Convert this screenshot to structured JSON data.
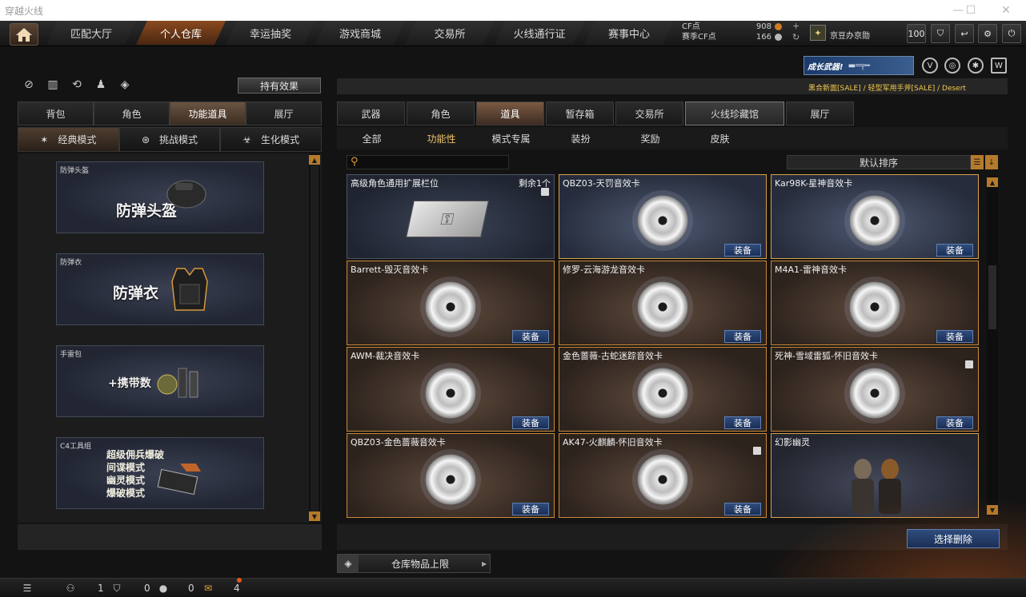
{
  "window": {
    "title": "穿越火线"
  },
  "nav": {
    "tabs": [
      "匹配大厅",
      "个人仓库",
      "幸运抽奖",
      "游戏商城",
      "交易所",
      "火线通行证",
      "赛事中心"
    ],
    "active_index": 1
  },
  "currency": {
    "cf_label": "CF点",
    "cf_value": "908",
    "season_label": "赛季CF点",
    "season_value": "166"
  },
  "user": {
    "rank_icon": "rank-icon",
    "name": "京豆办京勋"
  },
  "toolbar": {
    "level": "100"
  },
  "promo": {
    "text": "成长武器!"
  },
  "marquee": {
    "text": "黑合新面[SALE] / 轻型军用手斧[SALE] / Desert"
  },
  "left": {
    "effect_button": "持有效果",
    "tabs": [
      "背包",
      "角色",
      "功能道具",
      "展厅"
    ],
    "active_tab": 2,
    "modes": [
      "经典模式",
      "挑战模式",
      "生化模式"
    ],
    "active_mode": 0,
    "slots": [
      {
        "caption": "防弹头盔",
        "title": "防弹头盔"
      },
      {
        "caption": "防弹衣",
        "title": "防弹衣"
      },
      {
        "caption": "手雷包",
        "title": "+携带数"
      },
      {
        "caption": "C4工具组",
        "lines": [
          "超级佣兵爆破",
          "间谍模式",
          "幽灵模式",
          "爆破模式"
        ]
      }
    ]
  },
  "right": {
    "tabs": [
      "武器",
      "角色",
      "道具",
      "暂存箱",
      "交易所",
      "火线珍藏馆",
      "展厅"
    ],
    "active_tab": 2,
    "subtabs": [
      "全部",
      "功能性",
      "模式专属",
      "装扮",
      "奖励",
      "皮肤"
    ],
    "active_subtab": 1,
    "search_placeholder": "",
    "sort_label": "默认排序",
    "equip_label": "装备",
    "items": [
      {
        "name": "高级角色通用扩展栏位",
        "remaining": "剩余1个",
        "style": "plain",
        "equip": false,
        "lock": true
      },
      {
        "name": "QBZ03-天罚音效卡",
        "style": "blue",
        "equip": true,
        "lock": false
      },
      {
        "name": "Kar98K-星神音效卡",
        "style": "blue",
        "equip": true,
        "lock": false
      },
      {
        "name": "Barrett-毁灭音效卡",
        "style": "brown",
        "equip": true,
        "lock": false
      },
      {
        "name": "修罗-云海游龙音效卡",
        "style": "brown",
        "equip": true,
        "lock": false
      },
      {
        "name": "M4A1-雷神音效卡",
        "style": "brown",
        "equip": true,
        "lock": false
      },
      {
        "name": "AWM-裁决音效卡",
        "style": "brown",
        "equip": true,
        "lock": false
      },
      {
        "name": "金色蔷薇-古蛇迷踪音效卡",
        "style": "brown",
        "equip": true,
        "lock": false
      },
      {
        "name": "死神-雪域雷狐-怀旧音效卡",
        "style": "brown",
        "equip": true,
        "lock": true
      },
      {
        "name": "QBZ03-金色蔷薇音效卡",
        "style": "brown",
        "equip": true,
        "lock": false
      },
      {
        "name": "AK47-火麒麟-怀旧音效卡",
        "style": "brown",
        "equip": true,
        "lock": true
      },
      {
        "name": "幻影幽灵",
        "style": "ghost",
        "equip": false,
        "lock": false
      }
    ],
    "delete_button": "选择删除",
    "capacity_label": "仓库物品上限"
  },
  "status": {
    "friends": "1",
    "shield": "0",
    "messages": "0",
    "gifts": "4"
  }
}
